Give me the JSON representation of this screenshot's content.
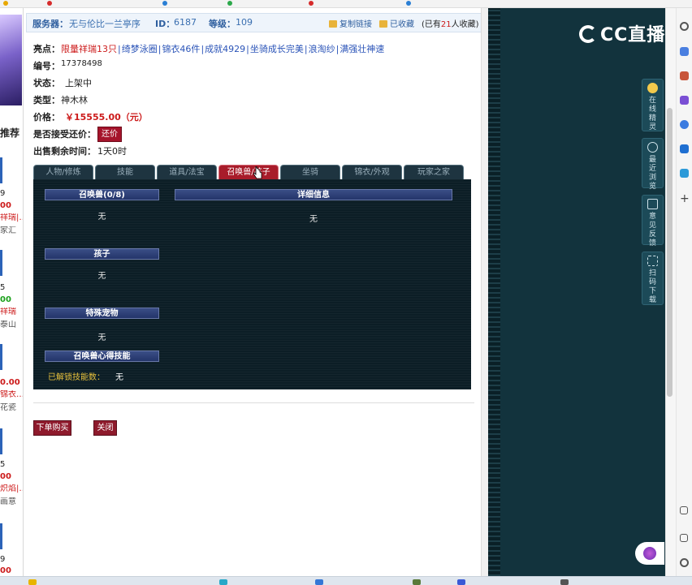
{
  "header": {
    "server_label": "服务器：",
    "server_value": "无与伦比一兰亭序",
    "id_label": "ID：",
    "id_value": "6187",
    "level_label": "等级：",
    "level_value": "109",
    "copy_link": "复制链接",
    "favorited": "已收藏",
    "fav_count_prefix": "(已有",
    "fav_count": "21",
    "fav_count_suffix": "人收藏)"
  },
  "info": {
    "highlights_label": "亮点：",
    "highlights": [
      "限量祥瑞13只",
      "绮梦泳圈",
      "锦衣46件",
      "成就4929",
      "坐骑成长完美",
      "浪淘纱",
      "满强壮神速"
    ],
    "highlight_separator": "|",
    "number_label": "编号：",
    "number_value": "17378498",
    "status_label": "状态：",
    "status_value": "上架中",
    "type_label": "类型：",
    "type_value": "神木林",
    "price_label": "价格：",
    "price_value": "￥15555.00（元）",
    "bargain_label": "是否接受还价：",
    "bargain_button": "还价",
    "remaining_label": "出售剩余时间：",
    "remaining_value": "1天0时"
  },
  "tabs": [
    "人物/修炼",
    "技能",
    "道具/法宝",
    "召唤兽/孩子",
    "坐骑",
    "锦衣/外观",
    "玩家之家"
  ],
  "active_tab_index": 3,
  "content": {
    "summon_header": "召唤兽(0/8)",
    "summon_value": "无",
    "detail_header": "详细信息",
    "detail_value": "无",
    "child_header": "孩子",
    "child_value": "无",
    "special_pet_header": "特殊宠物",
    "special_pet_value": "无",
    "summon_skill_header": "召唤兽心得技能",
    "unlocked_label": "已解锁技能数：",
    "unlocked_value": "无"
  },
  "actions": {
    "buy_button": "下单购买",
    "close_button": "关闭"
  },
  "left_column": {
    "recommend_title": "推荐",
    "rows": [
      "9",
      "00",
      "祥瑞|…",
      "家汇",
      "5",
      "00",
      "祥瑞",
      "泰山",
      "0.00",
      "锦衣…",
      "花瓷",
      "5",
      "00",
      "炽焰|…",
      "画意",
      "9",
      "00"
    ]
  },
  "side_panel": {
    "logo_text": "CC直播",
    "buttons": [
      "在线精灵",
      "最近浏览",
      "意见反馈",
      "扫码下载"
    ]
  },
  "colors": {
    "accent_red": "#a81c2a",
    "highlight_blue": "#2b54b8",
    "price_red": "#cc1a1a",
    "panel_dark": "#0c1e26",
    "side_teal": "#12333d"
  }
}
